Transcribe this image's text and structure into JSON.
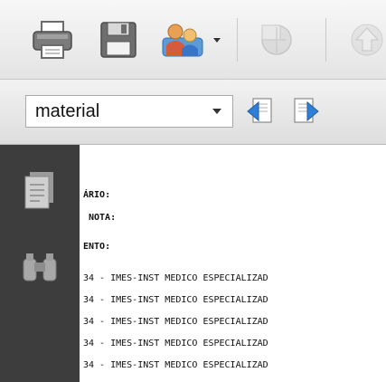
{
  "toolbar": {
    "print_icon": "printer-icon",
    "save_icon": "floppy-disk-icon",
    "share_icon": "people-share-icon",
    "share_dropdown_icon": "chevron-down-icon",
    "disabled_icon": "globe-icon",
    "up_icon": "arrow-up-icon"
  },
  "find": {
    "value": "material",
    "dropdown_icon": "chevron-down-icon",
    "prev_icon": "find-previous-icon",
    "next_icon": "find-next-icon"
  },
  "navpane": {
    "pages_icon": "pages-icon",
    "attachments_icon": "binoculars-icon"
  },
  "document": {
    "labels": [
      "ÁRIO:",
      "NOTA:",
      "ENTO:"
    ],
    "rows": [
      "34 - IMES-INST MEDICO ESPECIALIZAD",
      "34 - IMES-INST MEDICO ESPECIALIZAD",
      "34 - IMES-INST MEDICO ESPECIALIZAD",
      "34 - IMES-INST MEDICO ESPECIALIZAD",
      "34 - IMES-INST MEDICO ESPECIALIZAD"
    ]
  },
  "colors": {
    "navpane_bg": "#3d3d3d",
    "toolbar_bg": "#ececec",
    "accent_blue": "#2f7fd6"
  }
}
